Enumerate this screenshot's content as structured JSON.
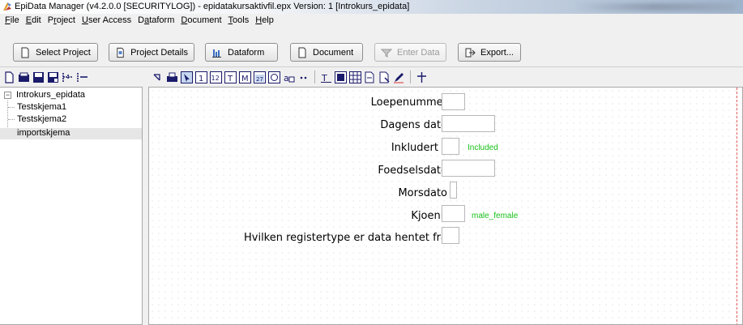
{
  "window": {
    "title": "EpiData Manager (v4.2.0.0 [SECURITYLOG]) - epidatakursaktivfil.epx Version: 1 [Introkurs_epidata]"
  },
  "menu": [
    {
      "label": "File",
      "acc": "F",
      "rest": "ile"
    },
    {
      "label": "Edit",
      "acc": "E",
      "rest": "dit"
    },
    {
      "label": "Project",
      "acc": "P",
      "rest": "roject"
    },
    {
      "label": "User Access",
      "acc": "U",
      "rest": "ser Access"
    },
    {
      "label": "Dataform",
      "acc": "D",
      "rest": "ataform"
    },
    {
      "label": "Document",
      "acc": "D",
      "rest": "ocument"
    },
    {
      "label": "Tools",
      "acc": "T",
      "rest": "ools"
    },
    {
      "label": "Help",
      "acc": "H",
      "rest": "elp"
    }
  ],
  "toolbar": {
    "select_project": "Select Project",
    "project_details": "Project Details",
    "dataform": "Dataform",
    "document": "Document",
    "enter_data": "Enter Data",
    "export": "Export..."
  },
  "tree": {
    "root": "Introkurs_epidata",
    "items": [
      "Testskjema1",
      "Testskjema2",
      "importskjema"
    ],
    "selected": "importskjema"
  },
  "form": {
    "fields": [
      {
        "label": "Loepenummer",
        "value": ""
      },
      {
        "label": "Dagens dato",
        "value": ""
      },
      {
        "label": "Inkludert",
        "value": "",
        "valuelabel": "Included"
      },
      {
        "label": "Foedselsdato",
        "value": ""
      },
      {
        "label": "Morsdato",
        "value": ""
      },
      {
        "label": "Kjoenn",
        "value": "",
        "valuelabel": "male_female"
      },
      {
        "label": "Hvilken registertype er data hentet fra",
        "value": ""
      }
    ]
  },
  "colors": {
    "valuelabel": "#19c219",
    "rightmargin": "#e05a5a"
  }
}
